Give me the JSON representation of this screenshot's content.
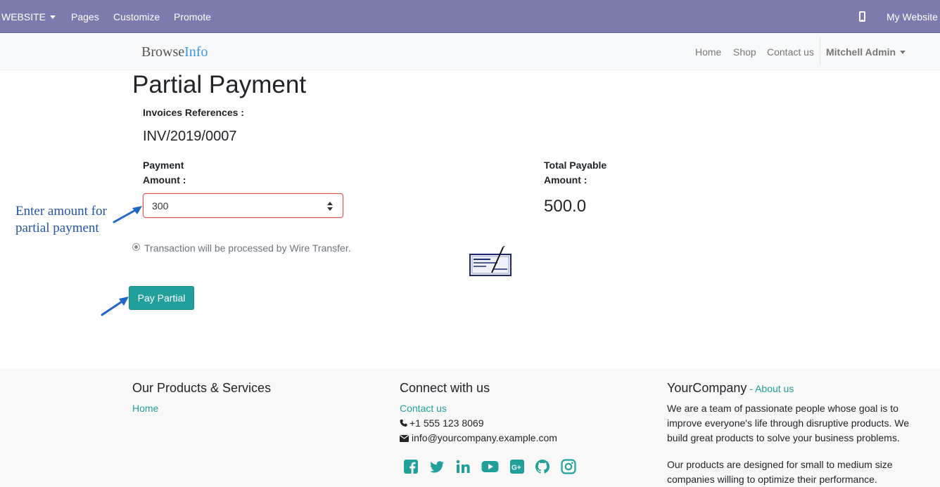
{
  "topbar": {
    "website_menu": "WEBSITE",
    "pages": "Pages",
    "customize": "Customize",
    "promote": "Promote",
    "my_website": "My Website",
    "phone_icon": "mobile-preview-icon",
    "colors": {
      "background": "#7c7bad"
    }
  },
  "navbar": {
    "brand_part1": "Browse",
    "brand_part2": "Info",
    "links": [
      "Home",
      "Shop",
      "Contact us"
    ],
    "user": "Mitchell Admin"
  },
  "main": {
    "title": "Partial Payment",
    "invoice_label": "Invoices References :",
    "invoice_value": "INV/2019/0007",
    "payment_label_line1": "Payment",
    "payment_label_line2": "Amount :",
    "payment_value": "300",
    "total_label_line1": "Total Payable",
    "total_label_line2": "Amount :",
    "total_value": "500.0",
    "radio_label": "Transaction will be processed by Wire Transfer.",
    "pay_button": "Pay Partial",
    "annotation_line1": "Enter amount for",
    "annotation_line2": "partial payment",
    "colors": {
      "accent": "#21a09b",
      "input_border": "#d9534f",
      "annotation": "#2255aa"
    }
  },
  "footer": {
    "col1": {
      "title": "Our Products & Services",
      "link": "Home"
    },
    "col2": {
      "title": "Connect with us",
      "contact_link": "Contact us",
      "phone": "+1 555 123 8069",
      "email": "info@yourcompany.example.com",
      "social_icons": [
        "facebook-icon",
        "twitter-icon",
        "linkedin-icon",
        "youtube-icon",
        "google-plus-icon",
        "github-icon",
        "instagram-icon"
      ]
    },
    "col3": {
      "company": "YourCompany",
      "dash": " - ",
      "about_link": "About us",
      "para1": "We are a team of passionate people whose goal is to improve everyone's life through disruptive products. We build great products to solve your business problems.",
      "para2": "Our products are designed for small to medium size companies willing to optimize their performance."
    }
  }
}
